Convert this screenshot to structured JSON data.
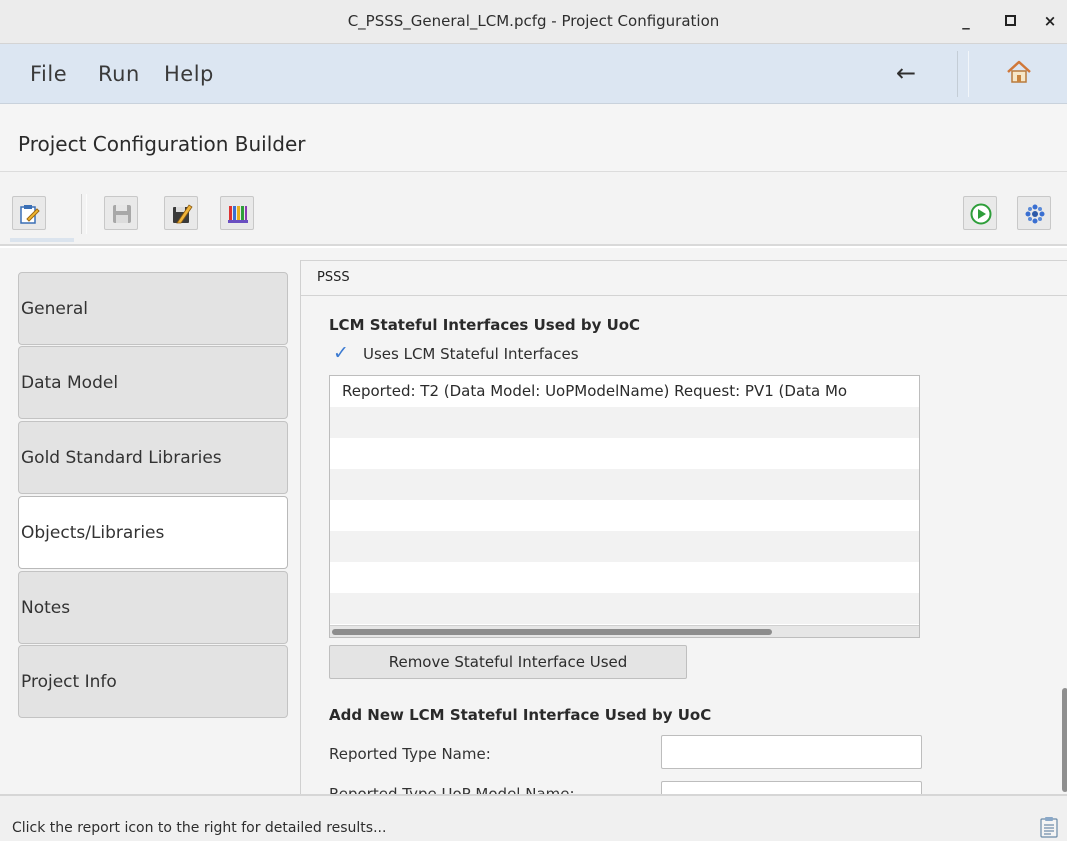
{
  "window": {
    "title": "C_PSSS_General_LCM.pcfg - Project Configuration",
    "minimize_label": "_",
    "maximize_label": "▫",
    "close_label": "×"
  },
  "menubar": {
    "items": [
      "File",
      "Run",
      "Help"
    ],
    "back_label": "←",
    "home_icon": "home-icon"
  },
  "header": {
    "title": "Project Configuration Builder"
  },
  "toolbar": {
    "buttons": [
      "edit-config-icon",
      "save-icon",
      "save-as-icon",
      "library-icon"
    ],
    "right_buttons": [
      "run-icon",
      "settings-icon"
    ],
    "accent_color": "#2e9e3a"
  },
  "sidebar": {
    "tabs": [
      {
        "label": "General",
        "active": false
      },
      {
        "label": "Data Model",
        "active": false
      },
      {
        "label": "Gold Standard Libraries",
        "active": false
      },
      {
        "label": "Objects/Libraries",
        "active": true
      },
      {
        "label": "Notes",
        "active": false
      },
      {
        "label": "Project Info",
        "active": false
      }
    ]
  },
  "panel": {
    "tab_label": "PSSS",
    "section1_title": "LCM Stateful Interfaces Used by UoC",
    "checkbox_label": "Uses LCM Stateful Interfaces",
    "checkbox_checked": true,
    "list_rows": [
      "Reported: T2 (Data Model: UoPModelName) Request: PV1 (Data Mo",
      "",
      "",
      "",
      "",
      "",
      "",
      ""
    ],
    "remove_button_label": "Remove Stateful Interface Used",
    "section2_title": "Add New LCM Stateful Interface Used by UoC",
    "field1_label": "Reported Type Name:",
    "field1_value": "",
    "field2_label": "Reported Type UoP Model Name:",
    "field2_value": ""
  },
  "statusbar": {
    "text": "Click the report icon to the right for detailed results...",
    "report_icon": "report-icon"
  }
}
